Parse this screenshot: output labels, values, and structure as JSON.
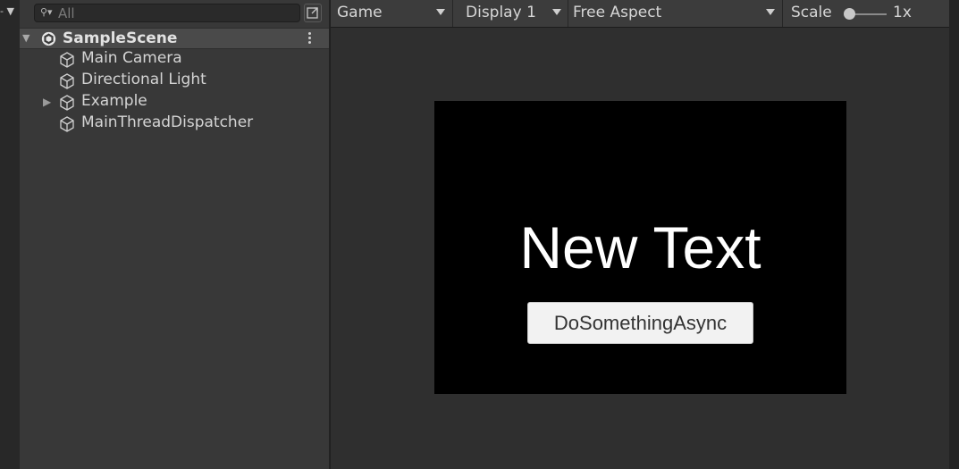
{
  "hierarchy": {
    "search": {
      "placeholder": "All"
    },
    "scene": {
      "name": "SampleScene"
    },
    "items": [
      {
        "label": "Main Camera",
        "expandable": false
      },
      {
        "label": "Directional Light",
        "expandable": false
      },
      {
        "label": "Example",
        "expandable": true
      },
      {
        "label": "MainThreadDispatcher",
        "expandable": false
      }
    ]
  },
  "game_toolbar": {
    "view_label": "Game",
    "display_label": "Display 1",
    "aspect_label": "Free Aspect",
    "scale_label": "Scale",
    "scale_value": "1x"
  },
  "game_view": {
    "text": "New Text",
    "button_label": "DoSomethingAsync"
  }
}
